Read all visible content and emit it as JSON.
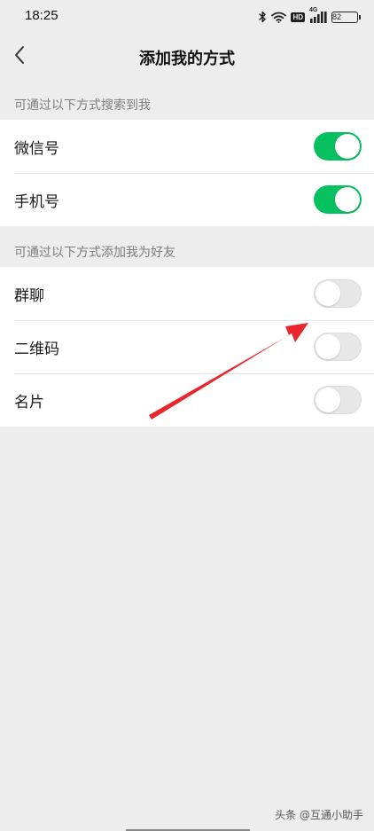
{
  "status_bar": {
    "time": "18:25",
    "hd_label": "HD",
    "network_label": "4G",
    "battery_level": "82"
  },
  "nav": {
    "title": "添加我的方式"
  },
  "section_search": {
    "header": "可通过以下方式搜索到我",
    "items": [
      {
        "label": "微信号",
        "enabled": true
      },
      {
        "label": "手机号",
        "enabled": true
      }
    ]
  },
  "section_add": {
    "header": "可通过以下方式添加我为好友",
    "items": [
      {
        "label": "群聊",
        "enabled": false
      },
      {
        "label": "二维码",
        "enabled": false
      },
      {
        "label": "名片",
        "enabled": false
      }
    ]
  },
  "watermark": "头条 @互通小助手",
  "colors": {
    "toggle_on": "#07c160",
    "toggle_off": "#e7e7e7",
    "arrow": "#e8262d",
    "background": "#ededed"
  },
  "icons": {
    "back": "chevron-left-icon",
    "bluetooth": "bluetooth-icon",
    "wifi": "wifi-icon",
    "signal": "signal-icon",
    "battery": "battery-icon"
  }
}
